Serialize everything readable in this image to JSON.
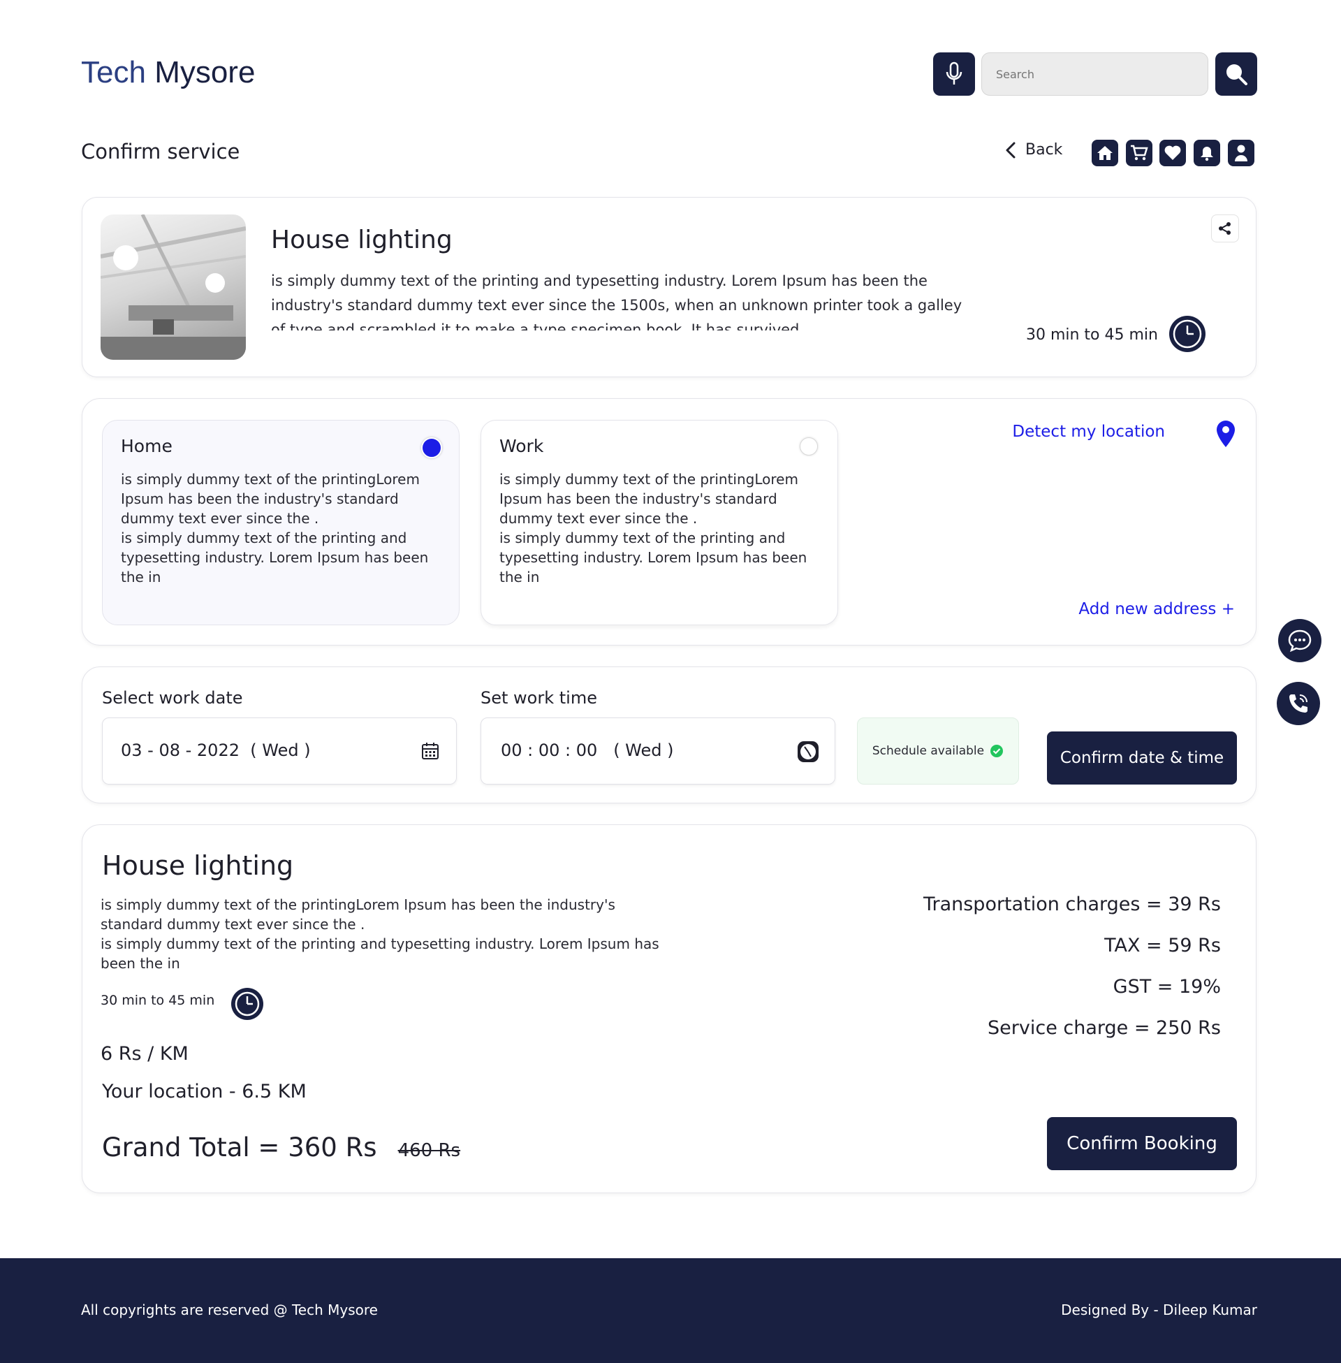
{
  "header": {
    "brand_first": "Tech",
    "brand_second": "Mysore",
    "search_placeholder": "Search",
    "page_title": "Confirm service",
    "back_label": "Back"
  },
  "service": {
    "title": "House lighting",
    "description": "is simply dummy text of the printing and typesetting industry. Lorem Ipsum has been the industry's standard dummy text ever since the 1500s, when an unknown printer took a galley of type and scrambled it to make a type specimen book. It has survived",
    "duration": "30 min to 45 min"
  },
  "addresses": {
    "home": {
      "label": "Home",
      "line1": "is simply dummy text of the printingLorem Ipsum has been the industry's standard dummy text ever since the .",
      "line2": "is simply dummy text of the printing and typesetting industry. Lorem Ipsum has been the in",
      "selected": true
    },
    "work": {
      "label": "Work",
      "line1": "is simply dummy text of the printingLorem Ipsum has been the industry's standard dummy text ever since the .",
      "line2": "is simply dummy text of the printing and typesetting industry. Lorem Ipsum has been the in",
      "selected": false
    },
    "detect_label": "Detect my location",
    "add_new_label": "Add new address +"
  },
  "schedule": {
    "date_label": "Select work date",
    "date_value": "03 - 08 - 2022  ( Wed )",
    "time_label": "Set work time",
    "time_value": "00 : 00 : 00   ( Wed )",
    "status": "Schedule available",
    "confirm_label": "Confirm date & time"
  },
  "summary": {
    "title": "House lighting",
    "line1": "is simply dummy text of the printingLorem Ipsum has been the industry's standard dummy text ever since the .",
    "line2": "is simply dummy text of the printing and typesetting industry. Lorem Ipsum has been the in",
    "duration": "30 min to 45 min",
    "rate": "6 Rs / KM",
    "distance": "Your location - 6.5 KM",
    "grand_total": "Grand Total = 360 Rs",
    "old_total": "460 Rs",
    "charges": {
      "transport": "Transportation charges = 39 Rs",
      "tax": "TAX = 59 Rs",
      "gst": "GST = 19%",
      "service": "Service charge = 250 Rs"
    },
    "confirm_label": "Confirm Booking"
  },
  "footer": {
    "copyright": "All copyrights are reserved @ Tech Mysore",
    "designer": "Designed By - Dileep Kumar"
  },
  "colors": {
    "navy": "#192041",
    "accent_blue": "#1c1de6",
    "success_green": "#22c55e"
  },
  "icons": [
    "mic-icon",
    "search-icon",
    "back-chevron-icon",
    "home-icon",
    "cart-icon",
    "heart-icon",
    "bell-icon",
    "user-icon",
    "share-icon",
    "clock-icon",
    "location-pin-icon",
    "calendar-icon",
    "chat-icon",
    "phone-icon",
    "check-circle-icon"
  ]
}
